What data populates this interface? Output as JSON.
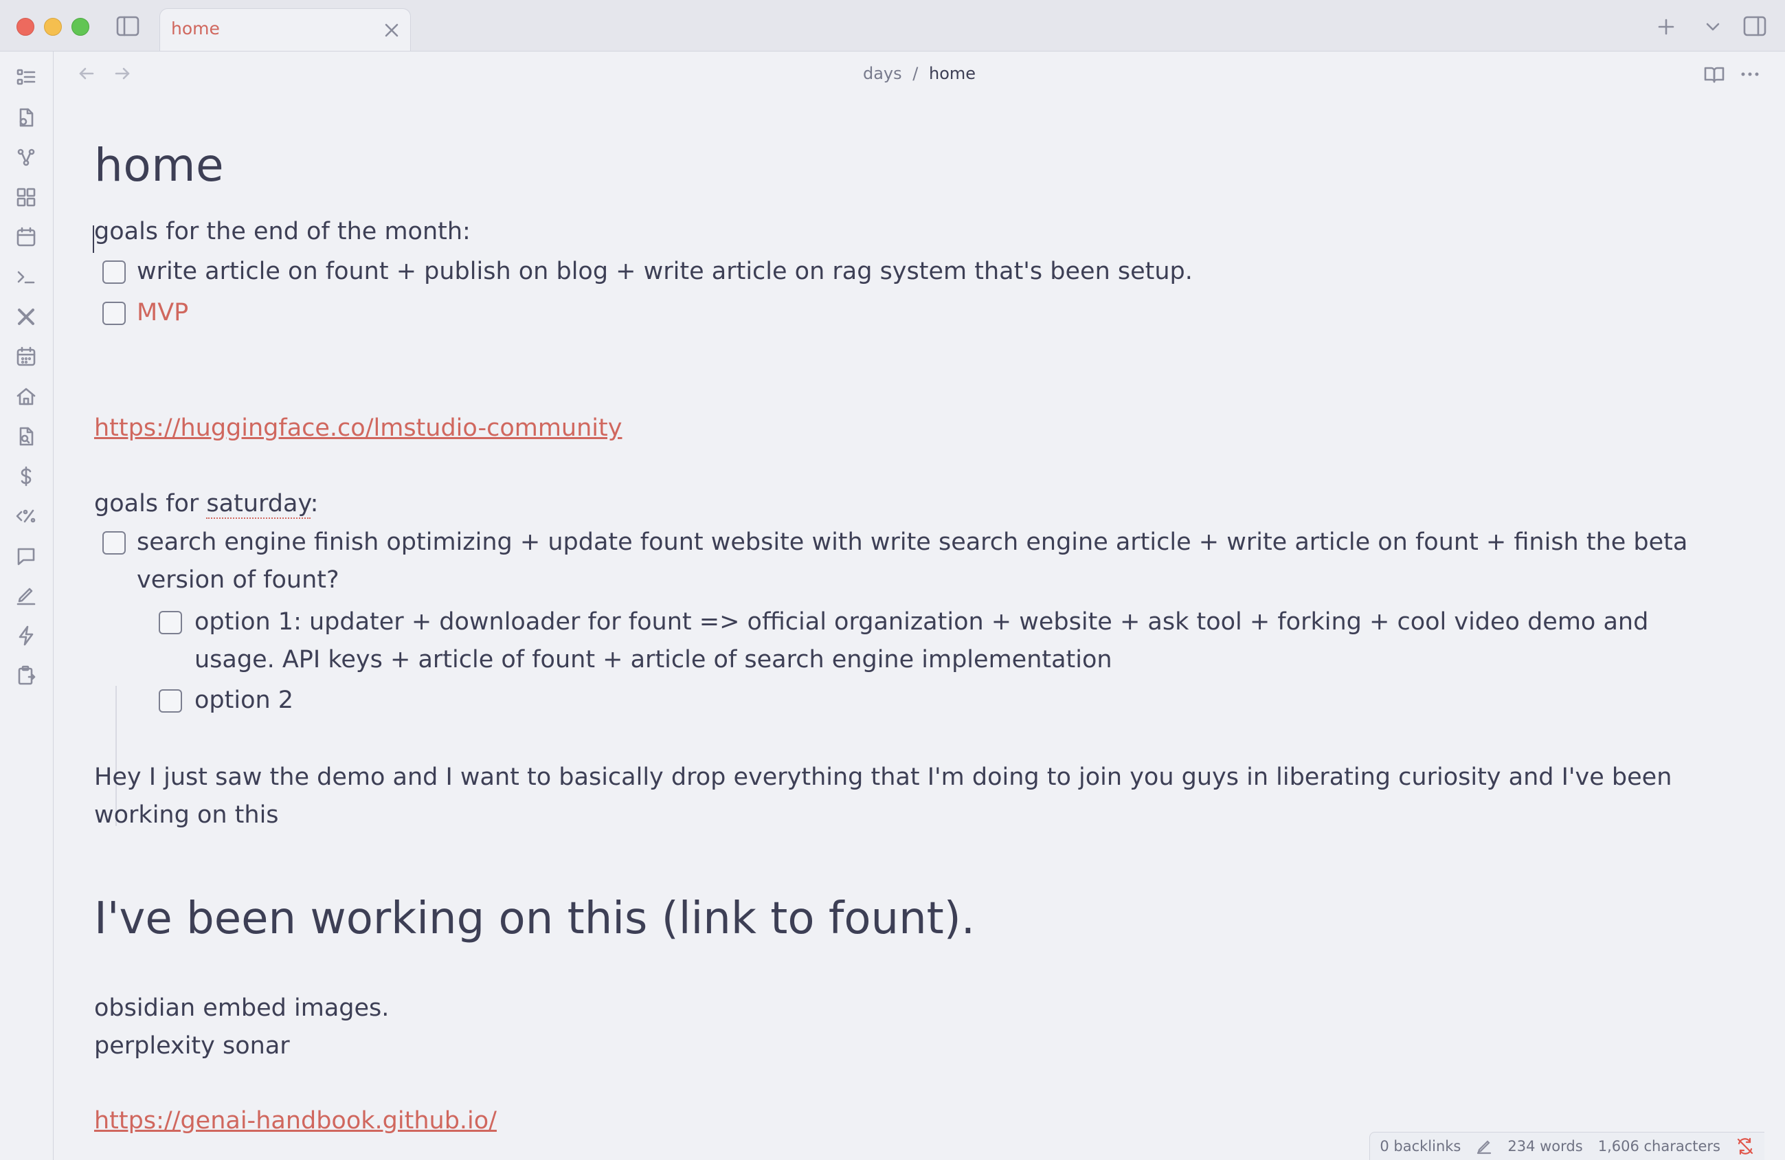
{
  "window": {
    "tab_title": "home"
  },
  "navbar": {
    "breadcrumb_parent": "days",
    "breadcrumb_separator": "/",
    "breadcrumb_current": "home"
  },
  "ribbon_icons": [
    "list-icon",
    "file-plus-icon",
    "graph-icon",
    "grid-icon",
    "calendar-icon",
    "terminal-icon",
    "tools-icon",
    "calendar-days-icon",
    "home-icon",
    "file-search-icon",
    "dollar-icon",
    "code-percent-icon",
    "chat-icon",
    "pen-icon",
    "lightning-icon",
    "clipboard-icon"
  ],
  "note": {
    "title": "home",
    "goals_month_heading": "goals for the end of the month:",
    "task_1": "write article on fount + publish on blog + write article on rag system that's been setup.",
    "task_2": "MVP",
    "link_1": "https://huggingface.co/lmstudio-community",
    "goals_saturday_prefix": "goals for ",
    "goals_saturday_word": "saturday",
    "goals_saturday_suffix": ":",
    "task_3": "search engine finish optimizing + update fount website with write search engine article + write article on fount + finish the beta version of fount?",
    "subtask_1": "option 1: updater + downloader for fount => official organization + website + ask tool + forking + cool video demo and usage. API keys + article of fount + article of search engine implementation",
    "subtask_2": "option 2",
    "paragraph": "Hey I just saw the demo and I want to basically drop everything that I'm doing to join you guys in liberating curiosity and I've been working on this",
    "heading_2": "I've been working on this (link to fount).",
    "line_1": "obsidian embed images.",
    "line_2": "perplexity sonar",
    "link_2": "https://genai-handbook.github.io/"
  },
  "status_bar": {
    "backlinks": "0 backlinks",
    "words": "234 words",
    "characters": "1,606 characters"
  }
}
